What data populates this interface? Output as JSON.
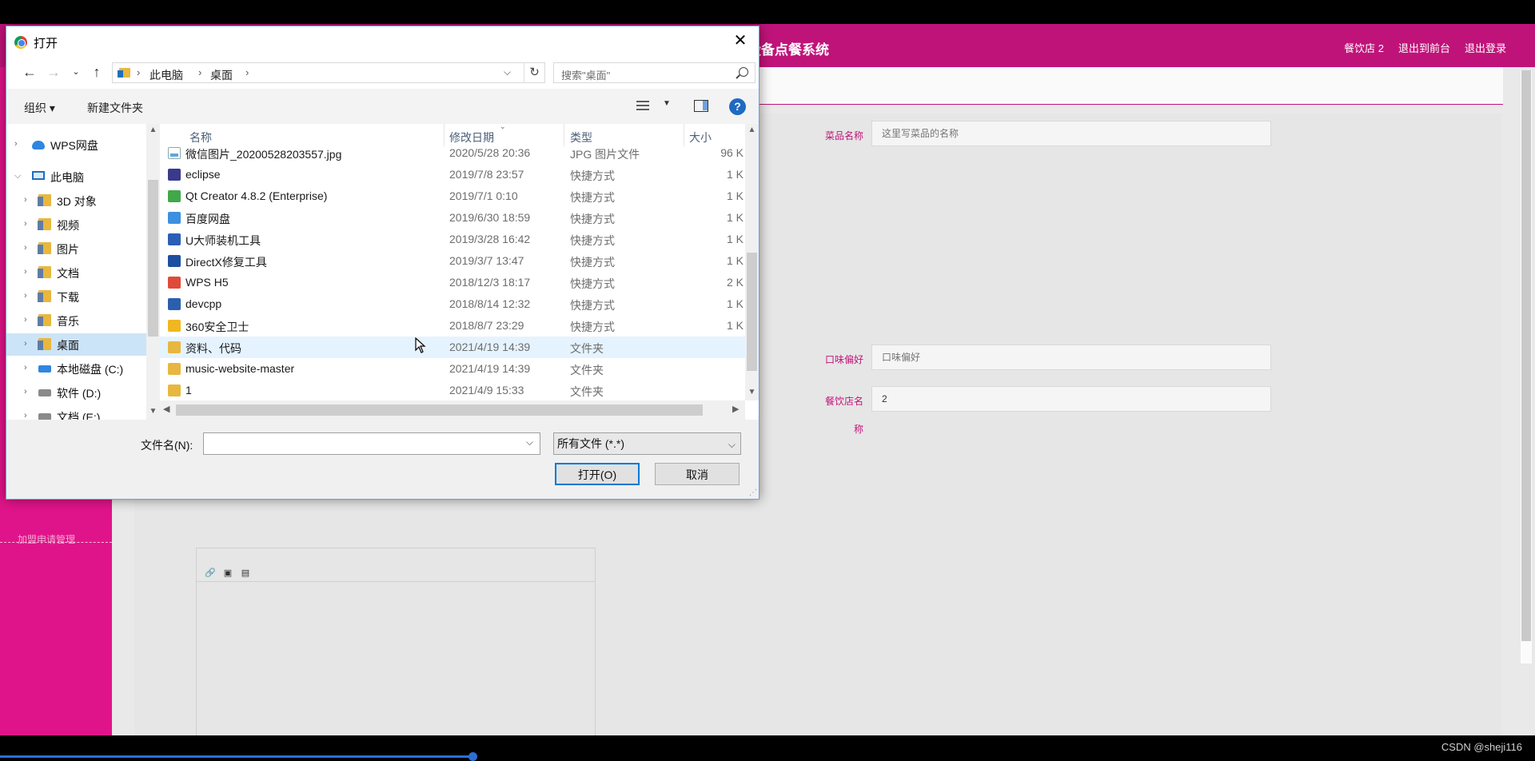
{
  "app": {
    "title": "设备点餐系统",
    "title_visible": "设备点餐系统",
    "nav": [
      "餐饮店 2",
      "退出到前台",
      "退出登录"
    ],
    "sidebar_faint": "加盟申请管理"
  },
  "form": {
    "dish_name_label": "菜品名称",
    "dish_name_placeholder": "这里写菜品的名称",
    "taste_label": "口味偏好",
    "taste_placeholder": "口味偏好",
    "shop_label_1": "餐饮店名",
    "shop_label_2": "称",
    "shop_value": "2"
  },
  "credit": "CSDN @sheji116",
  "dialog": {
    "title": "打开",
    "address": [
      "此电脑",
      "桌面"
    ],
    "search_placeholder": "搜索\"桌面\"",
    "cmd": {
      "organize": "组织 ▾",
      "new_folder": "新建文件夹"
    },
    "nav_items": [
      {
        "label": "WPS网盘",
        "icon": "cloud-icon"
      },
      {
        "label": "此电脑",
        "icon": "pc-icon"
      },
      {
        "label": "3D 对象",
        "icon": "folder-icon"
      },
      {
        "label": "视频",
        "icon": "folder-icon"
      },
      {
        "label": "图片",
        "icon": "folder-icon"
      },
      {
        "label": "文档",
        "icon": "folder-icon"
      },
      {
        "label": "下载",
        "icon": "folder-icon"
      },
      {
        "label": "音乐",
        "icon": "folder-icon"
      },
      {
        "label": "桌面",
        "icon": "folder-icon"
      },
      {
        "label": "本地磁盘 (C:)",
        "icon": "drive-icon"
      },
      {
        "label": "软件 (D:)",
        "icon": "drive-icon"
      },
      {
        "label": "文档 (E:)",
        "icon": "drive-icon"
      }
    ],
    "columns": [
      "名称",
      "修改日期",
      "类型",
      "大小"
    ],
    "files": [
      {
        "name": "微信图片_20200528203557.jpg",
        "date": "2020/5/28 20:36",
        "type": "JPG 图片文件",
        "size": "96 K"
      },
      {
        "name": "eclipse",
        "date": "2019/7/8 23:57",
        "type": "快捷方式",
        "size": "1 K"
      },
      {
        "name": "Qt Creator 4.8.2 (Enterprise)",
        "date": "2019/7/1 0:10",
        "type": "快捷方式",
        "size": "1 K"
      },
      {
        "name": "百度网盘",
        "date": "2019/6/30 18:59",
        "type": "快捷方式",
        "size": "1 K"
      },
      {
        "name": "U大师装机工具",
        "date": "2019/3/28 16:42",
        "type": "快捷方式",
        "size": "1 K"
      },
      {
        "name": "DirectX修复工具",
        "date": "2019/3/7 13:47",
        "type": "快捷方式",
        "size": "1 K"
      },
      {
        "name": "WPS H5",
        "date": "2018/12/3 18:17",
        "type": "快捷方式",
        "size": "2 K"
      },
      {
        "name": "devcpp",
        "date": "2018/8/14 12:32",
        "type": "快捷方式",
        "size": "1 K"
      },
      {
        "name": "360安全卫士",
        "date": "2018/8/7 23:29",
        "type": "快捷方式",
        "size": "1 K"
      },
      {
        "name": "资料、代码",
        "date": "2021/4/19 14:39",
        "type": "文件夹",
        "size": ""
      },
      {
        "name": "music-website-master",
        "date": "2021/4/19 14:39",
        "type": "文件夹",
        "size": ""
      },
      {
        "name": "1",
        "date": "2021/4/9 15:33",
        "type": "文件夹",
        "size": ""
      }
    ],
    "file_icon_colors": [
      "#ffffff",
      "#3a3a8c",
      "#41a84a",
      "#3d8fe0",
      "#2a5fb5",
      "#1d4fa0",
      "#e04a3a",
      "#2b5fae",
      "#f0b820",
      "#e8b740",
      "#e8b740",
      "#e8b740"
    ],
    "filename_label": "文件名(N):",
    "filename_value": "",
    "filter": "所有文件 (*.*)",
    "open_button": "打开(O)",
    "cancel_button": "取消"
  },
  "colors": {
    "brand": "#c0137a",
    "sidebar": "#e0148a",
    "selection": "#cce4f7",
    "hover": "#e5f3ff"
  }
}
